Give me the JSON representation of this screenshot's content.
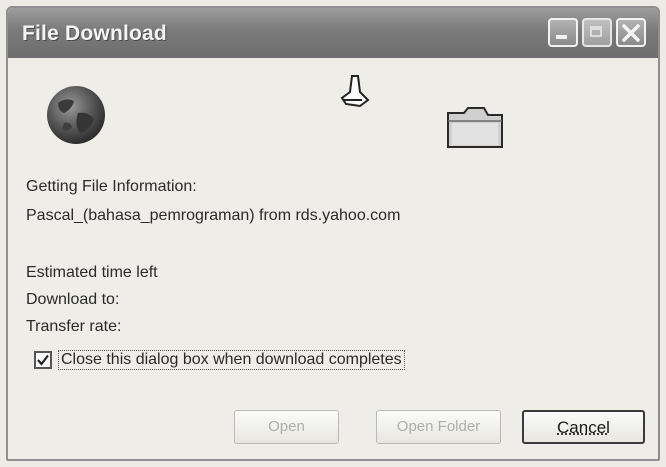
{
  "window": {
    "title": "File Download"
  },
  "status": {
    "getting_info": "Getting File Information:",
    "source": "Pascal_(bahasa_pemrograman) from rds.yahoo.com",
    "estimated_time_label": "Estimated time left",
    "download_to_label": "Download to:",
    "transfer_rate_label": "Transfer rate:"
  },
  "options": {
    "close_on_complete_label": "Close this dialog box when download completes",
    "close_on_complete_checked": true
  },
  "buttons": {
    "open": "Open",
    "open_folder": "Open Folder",
    "cancel": "Cancel"
  },
  "icons": {
    "globe": "globe-icon",
    "paper": "flying-paper-icon",
    "folder": "folder-icon"
  }
}
